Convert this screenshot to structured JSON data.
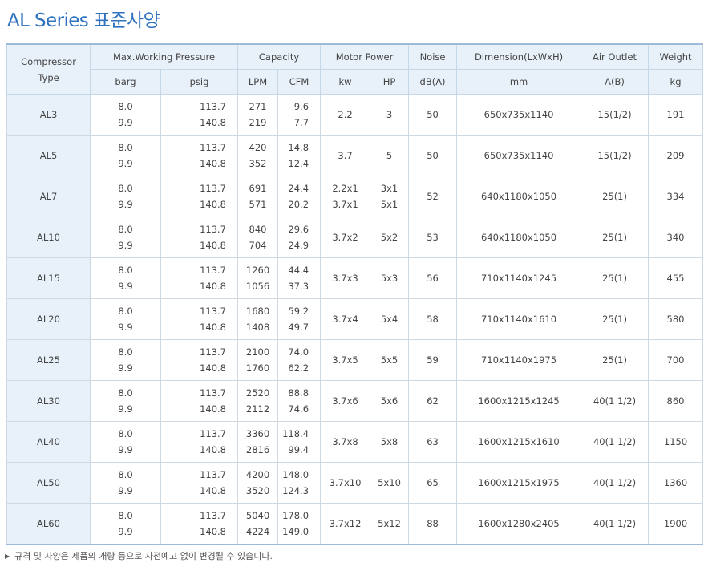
{
  "page": {
    "title": "AL Series 표준사양"
  },
  "table": {
    "header": {
      "compressor_type": [
        "Compressor",
        "Type"
      ],
      "max_pressure": "Max.Working Pressure",
      "capacity": "Capacity",
      "motor_power": "Motor Power",
      "noise": "Noise",
      "dimension": "Dimension(LxWxH)",
      "air_outlet": "Air Outlet",
      "weight": "Weight"
    },
    "units": {
      "barg": "barg",
      "psig": "psig",
      "lpm": "LPM",
      "cfm": "CFM",
      "kw": "kw",
      "hp": "HP",
      "noise": "dB(A)",
      "dimension": "mm",
      "air_outlet": "A(B)",
      "weight": "kg"
    },
    "rows": [
      {
        "type": "AL3",
        "barg": [
          "8.0",
          "9.9"
        ],
        "psig": [
          "113.7",
          "140.8"
        ],
        "lpm": [
          "271",
          "219"
        ],
        "cfm": [
          "9.6",
          "7.7"
        ],
        "kw": [
          "2.2"
        ],
        "hp": [
          "3"
        ],
        "noise": "50",
        "dimension": "650x735x1140",
        "outlet": "15(1/2)",
        "weight": "191"
      },
      {
        "type": "AL5",
        "barg": [
          "8.0",
          "9.9"
        ],
        "psig": [
          "113.7",
          "140.8"
        ],
        "lpm": [
          "420",
          "352"
        ],
        "cfm": [
          "14.8",
          "12.4"
        ],
        "kw": [
          "3.7"
        ],
        "hp": [
          "5"
        ],
        "noise": "50",
        "dimension": "650x735x1140",
        "outlet": "15(1/2)",
        "weight": "209"
      },
      {
        "type": "AL7",
        "barg": [
          "8.0",
          "9.9"
        ],
        "psig": [
          "113.7",
          "140.8"
        ],
        "lpm": [
          "691",
          "571"
        ],
        "cfm": [
          "24.4",
          "20.2"
        ],
        "kw": [
          "2.2x1",
          "3.7x1"
        ],
        "hp": [
          "3x1",
          "5x1"
        ],
        "noise": "52",
        "dimension": "640x1180x1050",
        "outlet": "25(1)",
        "weight": "334"
      },
      {
        "type": "AL10",
        "barg": [
          "8.0",
          "9.9"
        ],
        "psig": [
          "113.7",
          "140.8"
        ],
        "lpm": [
          "840",
          "704"
        ],
        "cfm": [
          "29.6",
          "24.9"
        ],
        "kw": [
          "3.7x2"
        ],
        "hp": [
          "5x2"
        ],
        "noise": "53",
        "dimension": "640x1180x1050",
        "outlet": "25(1)",
        "weight": "340"
      },
      {
        "type": "AL15",
        "barg": [
          "8.0",
          "9.9"
        ],
        "psig": [
          "113.7",
          "140.8"
        ],
        "lpm": [
          "1260",
          "1056"
        ],
        "cfm": [
          "44.4",
          "37.3"
        ],
        "kw": [
          "3.7x3"
        ],
        "hp": [
          "5x3"
        ],
        "noise": "56",
        "dimension": "710x1140x1245",
        "outlet": "25(1)",
        "weight": "455"
      },
      {
        "type": "AL20",
        "barg": [
          "8.0",
          "9.9"
        ],
        "psig": [
          "113.7",
          "140.8"
        ],
        "lpm": [
          "1680",
          "1408"
        ],
        "cfm": [
          "59.2",
          "49.7"
        ],
        "kw": [
          "3.7x4"
        ],
        "hp": [
          "5x4"
        ],
        "noise": "58",
        "dimension": "710x1140x1610",
        "outlet": "25(1)",
        "weight": "580"
      },
      {
        "type": "AL25",
        "barg": [
          "8.0",
          "9.9"
        ],
        "psig": [
          "113.7",
          "140.8"
        ],
        "lpm": [
          "2100",
          "1760"
        ],
        "cfm": [
          "74.0",
          "62.2"
        ],
        "kw": [
          "3.7x5"
        ],
        "hp": [
          "5x5"
        ],
        "noise": "59",
        "dimension": "710x1140x1975",
        "outlet": "25(1)",
        "weight": "700"
      },
      {
        "type": "AL30",
        "barg": [
          "8.0",
          "9.9"
        ],
        "psig": [
          "113.7",
          "140.8"
        ],
        "lpm": [
          "2520",
          "2112"
        ],
        "cfm": [
          "88.8",
          "74.6"
        ],
        "kw": [
          "3.7x6"
        ],
        "hp": [
          "5x6"
        ],
        "noise": "62",
        "dimension": "1600x1215x1245",
        "outlet": "40(1 1/2)",
        "weight": "860"
      },
      {
        "type": "AL40",
        "barg": [
          "8.0",
          "9.9"
        ],
        "psig": [
          "113.7",
          "140.8"
        ],
        "lpm": [
          "3360",
          "2816"
        ],
        "cfm": [
          "118.4",
          "99.4"
        ],
        "kw": [
          "3.7x8"
        ],
        "hp": [
          "5x8"
        ],
        "noise": "63",
        "dimension": "1600x1215x1610",
        "outlet": "40(1 1/2)",
        "weight": "1150"
      },
      {
        "type": "AL50",
        "barg": [
          "8.0",
          "9.9"
        ],
        "psig": [
          "113.7",
          "140.8"
        ],
        "lpm": [
          "4200",
          "3520"
        ],
        "cfm": [
          "148.0",
          "124.3"
        ],
        "kw": [
          "3.7x10"
        ],
        "hp": [
          "5x10"
        ],
        "noise": "65",
        "dimension": "1600x1215x1975",
        "outlet": "40(1 1/2)",
        "weight": "1360"
      },
      {
        "type": "AL60",
        "barg": [
          "8.0",
          "9.9"
        ],
        "psig": [
          "113.7",
          "140.8"
        ],
        "lpm": [
          "5040",
          "4224"
        ],
        "cfm": [
          "178.0",
          "149.0"
        ],
        "kw": [
          "3.7x12"
        ],
        "hp": [
          "5x12"
        ],
        "noise": "88",
        "dimension": "1600x1280x2405",
        "outlet": "40(1 1/2)",
        "weight": "1900"
      }
    ]
  },
  "footnote": {
    "icon": "triangle-right-icon",
    "text": "규격 및 사양은 제품의 개량 등으로 사전예고 없이 변경될 수 있습니다."
  },
  "colors": {
    "title": "#2f72bf",
    "header_bg": "#e8f1fa",
    "border": "#c5d6e7",
    "accent_border": "#9dbbd9"
  }
}
